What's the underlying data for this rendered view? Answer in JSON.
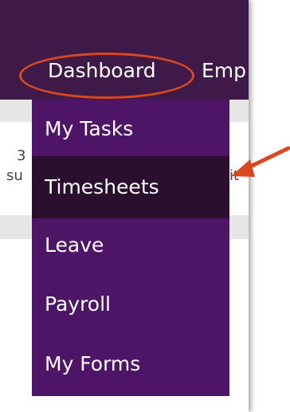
{
  "nav": {
    "dashboard_label": "Dashboard",
    "employees_label_partial": "Emp"
  },
  "dropdown": {
    "items": [
      {
        "label": "My Tasks"
      },
      {
        "label": "Timesheets"
      },
      {
        "label": "Leave"
      },
      {
        "label": "Payroll"
      },
      {
        "label": "My Forms"
      }
    ],
    "active_index": 1
  },
  "background": {
    "fragment_1": "3",
    "fragment_2": "su",
    "fragment_3": "it"
  },
  "colors": {
    "topbar": "#3f1a49",
    "dropdown": "#4e1566",
    "active_item": "#2a0f2f",
    "annotation": "#d9481f",
    "band": "#e6e6e6"
  },
  "annotations": {
    "ellipse_target": "Dashboard",
    "arrow_target": "Timesheets"
  }
}
